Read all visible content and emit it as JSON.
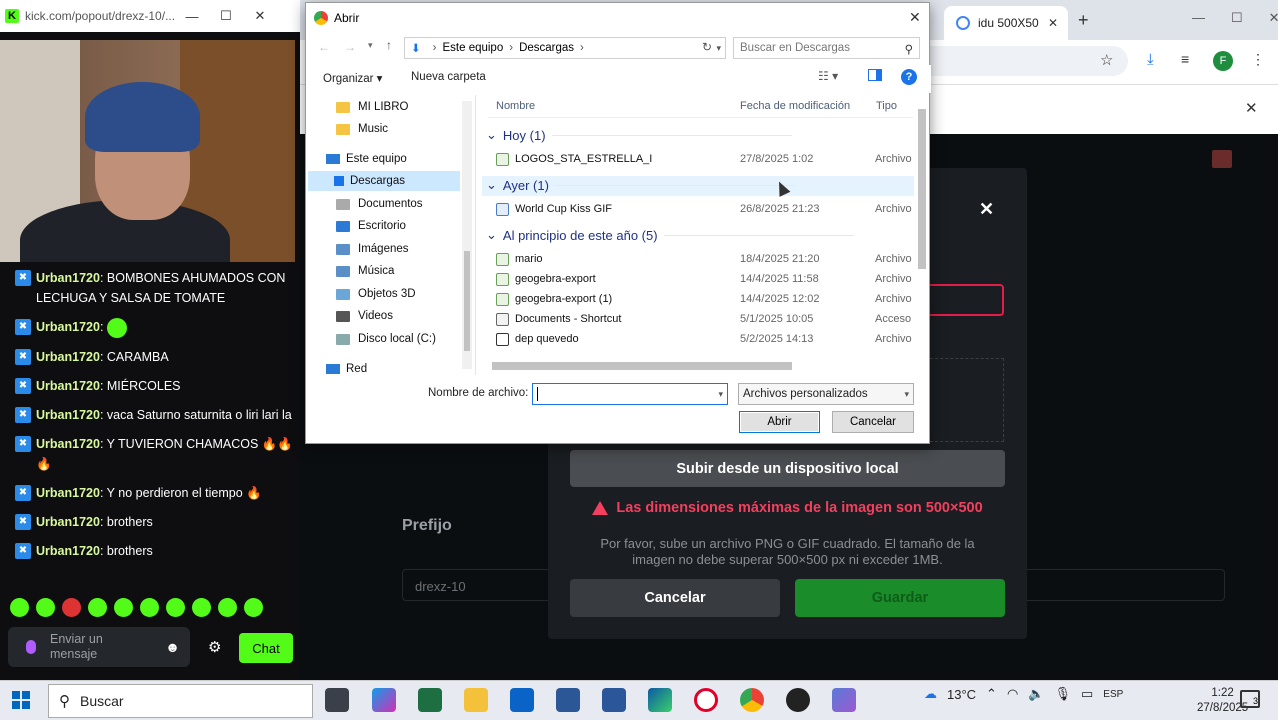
{
  "popout": {
    "url": "kick.com/popout/drexz-10/...",
    "chat": [
      {
        "user": "Urban1720",
        "text": "BOMBONES AHUMADOS CON LECHUGA Y SALSA DE TOMATE"
      },
      {
        "user": "Urban1720",
        "text": ""
      },
      {
        "user": "Urban1720",
        "text": "CARAMBA"
      },
      {
        "user": "Urban1720",
        "text": "MIÉRCOLES"
      },
      {
        "user": "Urban1720",
        "text": "vaca Saturno saturnita o liri lari la"
      },
      {
        "user": "Urban1720",
        "text": "Y TUVIERON CHAMACOS 🔥🔥🔥"
      },
      {
        "user": "Urban1720",
        "text": "Y no perdieron el tiempo 🔥"
      },
      {
        "user": "Urban1720",
        "text": "brothers"
      },
      {
        "user": "Urban1720",
        "text": "brothers"
      }
    ],
    "input_placeholder": "Enviar un mensaje",
    "chat_button": "Chat"
  },
  "browser": {
    "tab_title": "idu 500X50",
    "avatar_letter": "F"
  },
  "kick": {
    "prefix_label": "Prefijo",
    "prefix_value": "drexz-10",
    "modal": {
      "upload_button": "Subir desde un dispositivo local",
      "error": "Las dimensiones máximas de la imagen son 500×500",
      "hint": "Por favor, sube un archivo PNG o GIF cuadrado. El tamaño de la imagen no debe superar 500×500 px ni exceder 1MB.",
      "cancel": "Cancelar",
      "save": "Guardar"
    }
  },
  "dialog": {
    "title": "Abrir",
    "path": [
      "Este equipo",
      "Descargas"
    ],
    "search_placeholder": "Buscar en Descargas",
    "organize": "Organizar ▾",
    "new_folder": "Nueva carpeta",
    "nav": [
      {
        "label": "MI LIBRO"
      },
      {
        "label": "Music"
      },
      {
        "label": "Este equipo"
      },
      {
        "label": "Descargas"
      },
      {
        "label": "Documentos"
      },
      {
        "label": "Escritorio"
      },
      {
        "label": "Imágenes"
      },
      {
        "label": "Música"
      },
      {
        "label": "Objetos 3D"
      },
      {
        "label": "Videos"
      },
      {
        "label": "Disco local (C:)"
      },
      {
        "label": "Red"
      }
    ],
    "columns": {
      "name": "Nombre",
      "date": "Fecha de modificación",
      "type": "Tipo"
    },
    "groups": [
      {
        "label": "Hoy (1)",
        "files": [
          {
            "name": "LOGOS_STA_ESTRELLA_I",
            "date": "27/8/2025 1:02",
            "type": "Archivo"
          }
        ]
      },
      {
        "label": "Ayer (1)",
        "files": [
          {
            "name": "World Cup Kiss GIF",
            "date": "26/8/2025 21:23",
            "type": "Archivo"
          }
        ]
      },
      {
        "label": "Al principio de este año (5)",
        "files": [
          {
            "name": "mario",
            "date": "18/4/2025 21:20",
            "type": "Archivo"
          },
          {
            "name": "geogebra-export",
            "date": "14/4/2025 11:58",
            "type": "Archivo"
          },
          {
            "name": "geogebra-export (1)",
            "date": "14/4/2025 12:02",
            "type": "Archivo"
          },
          {
            "name": "Documents - Shortcut",
            "date": "5/1/2025 10:05",
            "type": "Acceso"
          },
          {
            "name": "dep quevedo",
            "date": "5/2/2025 14:13",
            "type": "Archivo"
          }
        ]
      }
    ],
    "filename_label": "Nombre de archivo:",
    "filename_value": "",
    "filter": "Archivos personalizados",
    "open": "Abrir",
    "cancel": "Cancelar"
  },
  "taskbar": {
    "search": "Buscar",
    "temperature": "13°C",
    "lang": "ESP",
    "time": "1:22",
    "date": "27/8/2025",
    "notifications": "3"
  },
  "colors": {
    "kick_green": "#53fc18",
    "error_red": "#f43f5e",
    "save_green": "#1a8d2a"
  }
}
